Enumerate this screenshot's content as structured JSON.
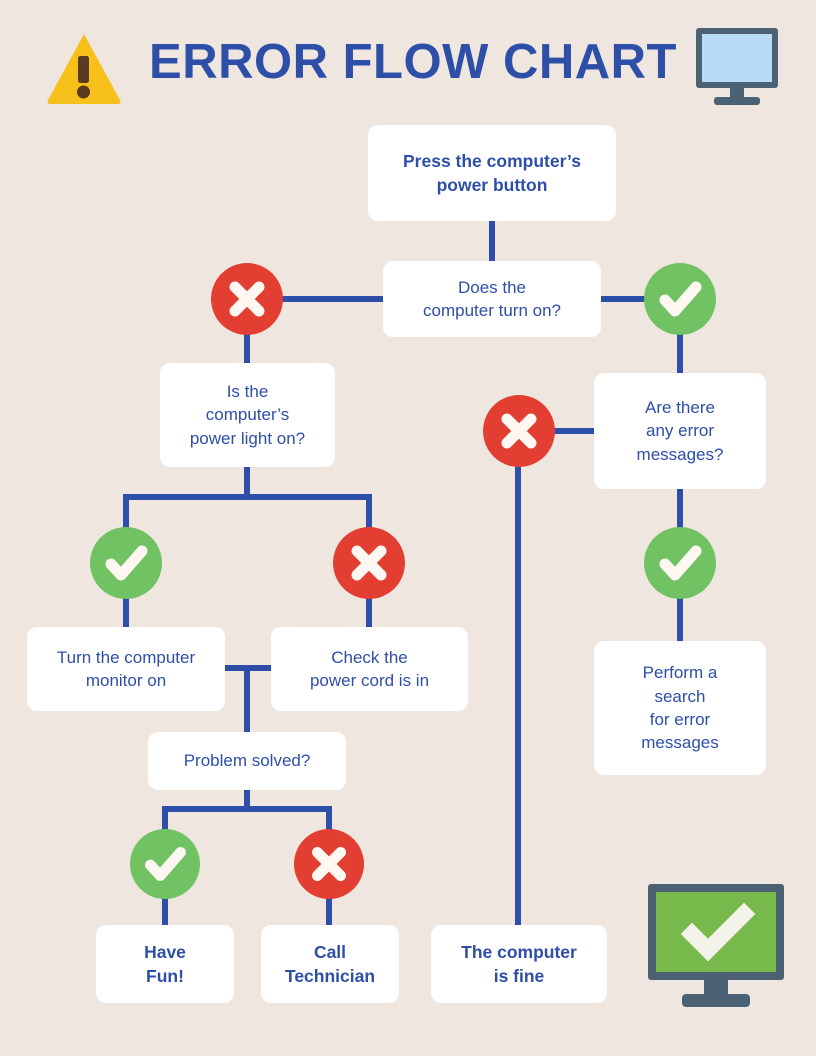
{
  "header": {
    "title": "ERROR FLOW CHART",
    "warning_icon": "warning-triangle-icon",
    "monitor_icon": "computer-monitor-icon"
  },
  "footer": {
    "monitor_ok_icon": "monitor-check-icon"
  },
  "colors": {
    "background": "#EFE7DF",
    "accent_blue": "#2E4FA8",
    "red": "#E23F32",
    "green": "#70C263",
    "box": "#FFFFFF",
    "warning_yellow": "#F8C01B",
    "monitor_frame": "#4A6273",
    "monitor_screen": "#B8DCF5",
    "monitor_screen_ok": "#77B94A"
  },
  "nodes": {
    "start": "Press the computer’s\npower button",
    "turn_on": "Does the\ncomputer turn on?",
    "power_light": "Is the\ncomputer’s\npower light on?",
    "error_messages": "Are there\nany error\nmessages?",
    "monitor_on": "Turn the computer\nmonitor on",
    "power_cord": "Check the\npower cord is in",
    "search_errors": "Perform a\nsearch\nfor error\nmessages",
    "problem_solved": "Problem solved?",
    "have_fun": "Have\nFun!",
    "call_technician": "Call\nTechnician",
    "computer_fine": "The computer\nis fine"
  },
  "markers": {
    "turn_on_no": "red-x-icon",
    "turn_on_yes": "green-check-icon",
    "errors_no": "red-x-icon",
    "errors_yes": "green-check-icon",
    "light_yes": "green-check-icon",
    "light_no": "red-x-icon",
    "solved_yes": "green-check-icon",
    "solved_no": "red-x-icon"
  },
  "chart_data": {
    "type": "diagram",
    "title": "ERROR FLOW CHART",
    "nodes": [
      {
        "id": "start",
        "label": "Press the computer’s power button",
        "kind": "process"
      },
      {
        "id": "turn_on",
        "label": "Does the computer turn on?",
        "kind": "decision"
      },
      {
        "id": "power_light",
        "label": "Is the computer’s power light on?",
        "kind": "decision"
      },
      {
        "id": "error_messages",
        "label": "Are there any error messages?",
        "kind": "decision"
      },
      {
        "id": "monitor_on",
        "label": "Turn the computer monitor on",
        "kind": "process"
      },
      {
        "id": "power_cord",
        "label": "Check the power cord is in",
        "kind": "process"
      },
      {
        "id": "search_errors",
        "label": "Perform a search for error messages",
        "kind": "process"
      },
      {
        "id": "problem_solved",
        "label": "Problem solved?",
        "kind": "decision"
      },
      {
        "id": "have_fun",
        "label": "Have Fun!",
        "kind": "terminal"
      },
      {
        "id": "call_technician",
        "label": "Call Technician",
        "kind": "terminal"
      },
      {
        "id": "computer_fine",
        "label": "The computer is fine",
        "kind": "terminal"
      }
    ],
    "edges": [
      {
        "from": "start",
        "to": "turn_on",
        "label": ""
      },
      {
        "from": "turn_on",
        "to": "power_light",
        "label": "no"
      },
      {
        "from": "turn_on",
        "to": "error_messages",
        "label": "yes"
      },
      {
        "from": "error_messages",
        "to": "computer_fine",
        "label": "no"
      },
      {
        "from": "error_messages",
        "to": "search_errors",
        "label": "yes"
      },
      {
        "from": "power_light",
        "to": "monitor_on",
        "label": "yes"
      },
      {
        "from": "power_light",
        "to": "power_cord",
        "label": "no"
      },
      {
        "from": "monitor_on",
        "to": "problem_solved",
        "label": ""
      },
      {
        "from": "power_cord",
        "to": "problem_solved",
        "label": ""
      },
      {
        "from": "problem_solved",
        "to": "have_fun",
        "label": "yes"
      },
      {
        "from": "problem_solved",
        "to": "call_technician",
        "label": "no"
      }
    ]
  }
}
